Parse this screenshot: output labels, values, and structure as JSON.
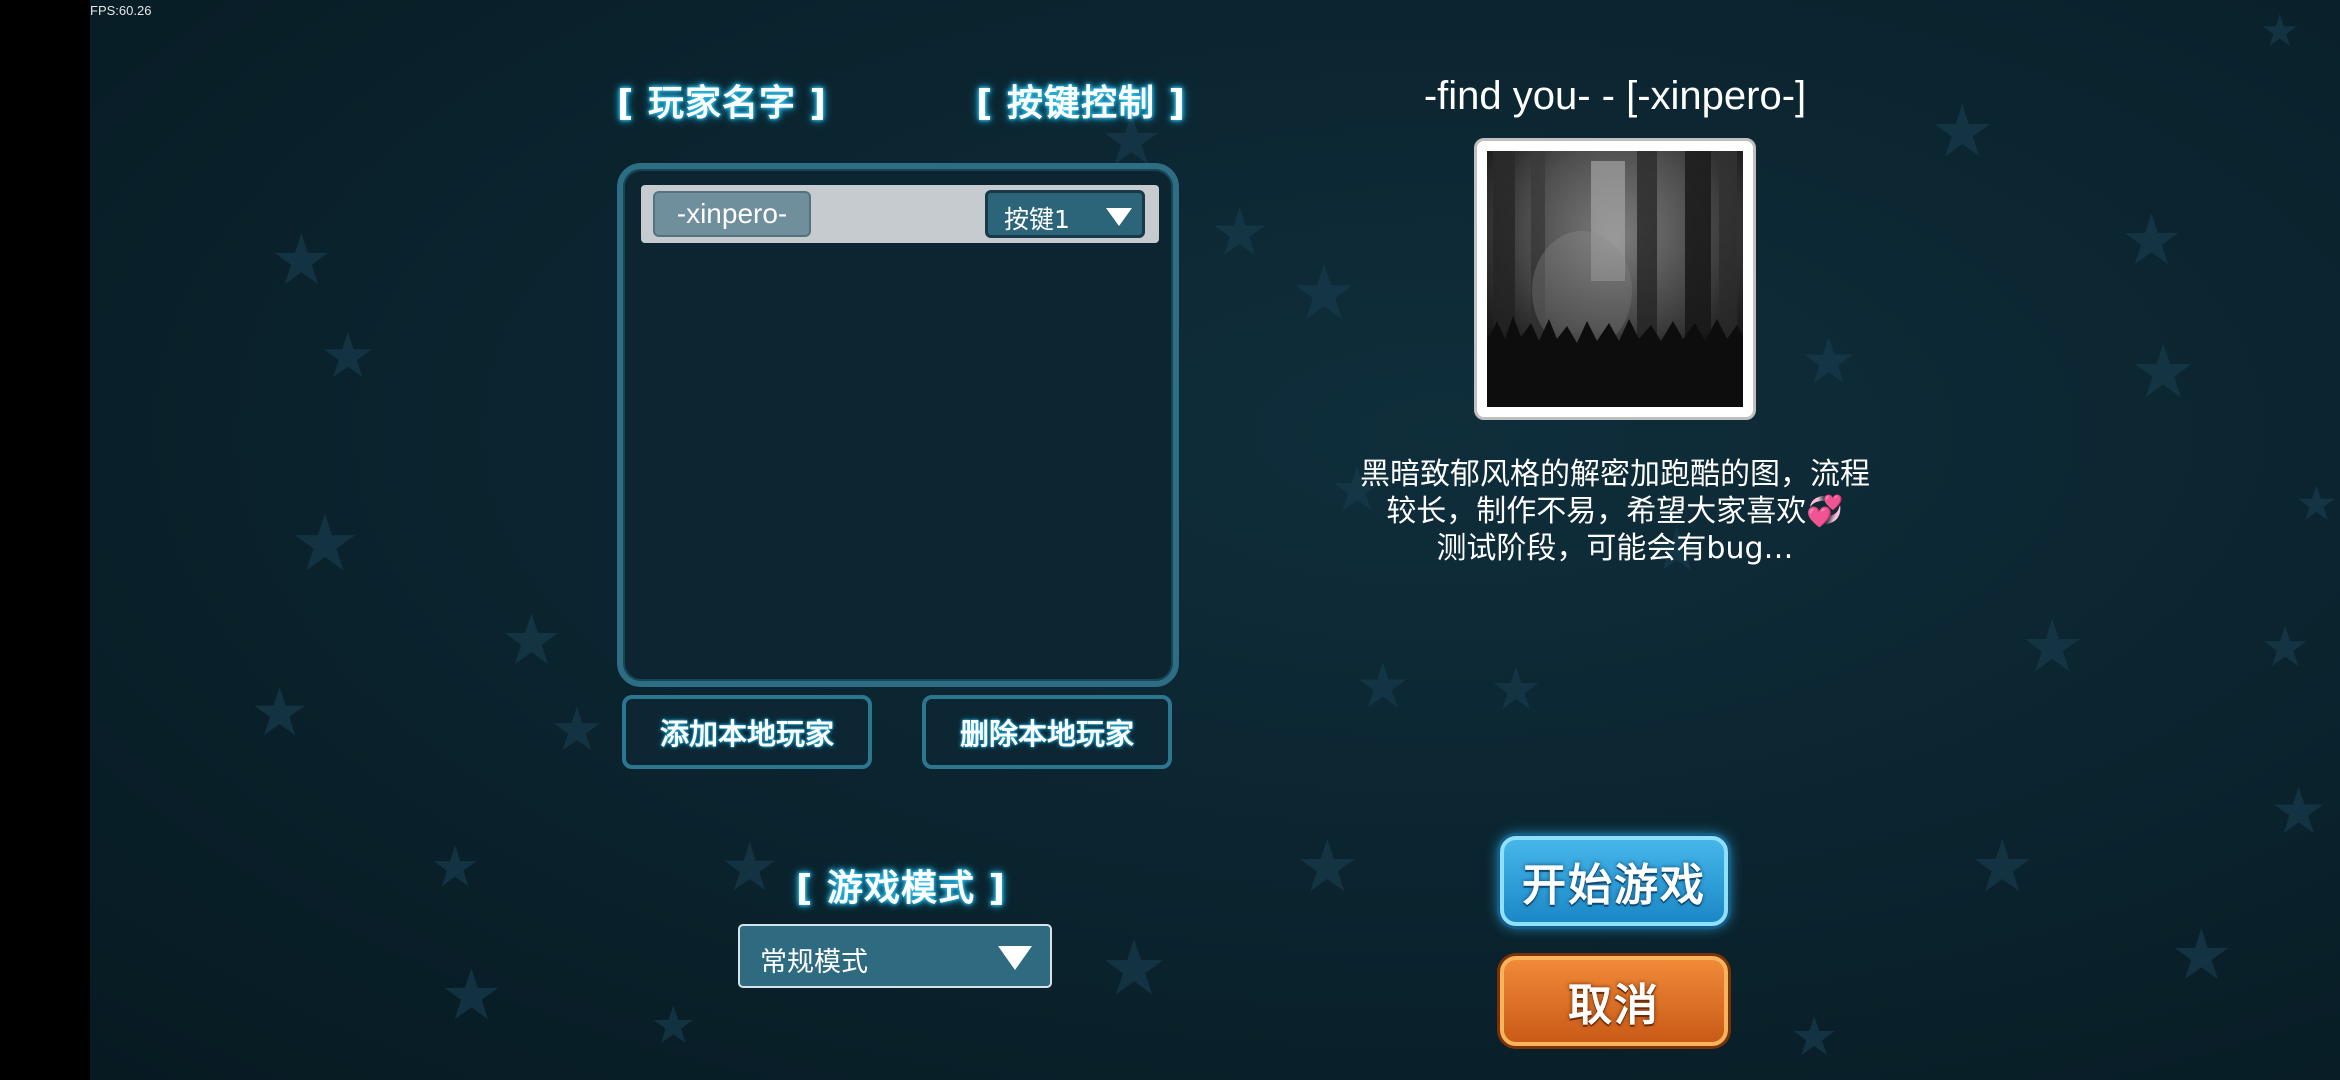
{
  "hud": {
    "fps": "FPS:60.26"
  },
  "headings": {
    "player_name": "[ 玩家名字 ]",
    "key_control": "[ 按键控制 ]",
    "game_mode": "[ 游戏模式 ]"
  },
  "players": [
    {
      "name": "-xinpero-",
      "key": "按键1"
    }
  ],
  "buttons": {
    "add_local_player": "添加本地玩家",
    "remove_local_player": "删除本地玩家",
    "start_game": "开始游戏",
    "cancel": "取消"
  },
  "game_mode": {
    "selected": "常规模式"
  },
  "map": {
    "title": "-find you- - [-xinpero-]",
    "description_lines": [
      "黑暗致郁风格的解密加跑酷的图，流程",
      "较长，制作不易，希望大家喜欢💞",
      "测试阶段，可能会有bug…"
    ]
  },
  "icons": {
    "dropdown": "triangle-down-icon",
    "background": "star-icon",
    "thumbnail": "dark-forest-thumbnail"
  },
  "colors": {
    "background": "#0b2530",
    "neon_glow": "#2ec2ee",
    "start_button": "#2a9ad6",
    "cancel_button": "#e07428",
    "panel_border": "#2d6e84"
  }
}
